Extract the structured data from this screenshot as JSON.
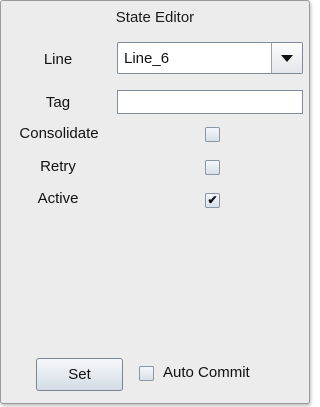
{
  "title": "State Editor",
  "form": {
    "line_label": "Line",
    "line_value": "Line_6",
    "tag_label": "Tag",
    "tag_value": "",
    "consolidate_label": "Consolidate",
    "consolidate_checked": false,
    "retry_label": "Retry",
    "retry_checked": false,
    "active_label": "Active",
    "active_checked": true
  },
  "footer": {
    "set_label": "Set",
    "auto_commit_label": "Auto Commit",
    "auto_commit_checked": false
  },
  "icons": {
    "check_glyph": "✔"
  }
}
